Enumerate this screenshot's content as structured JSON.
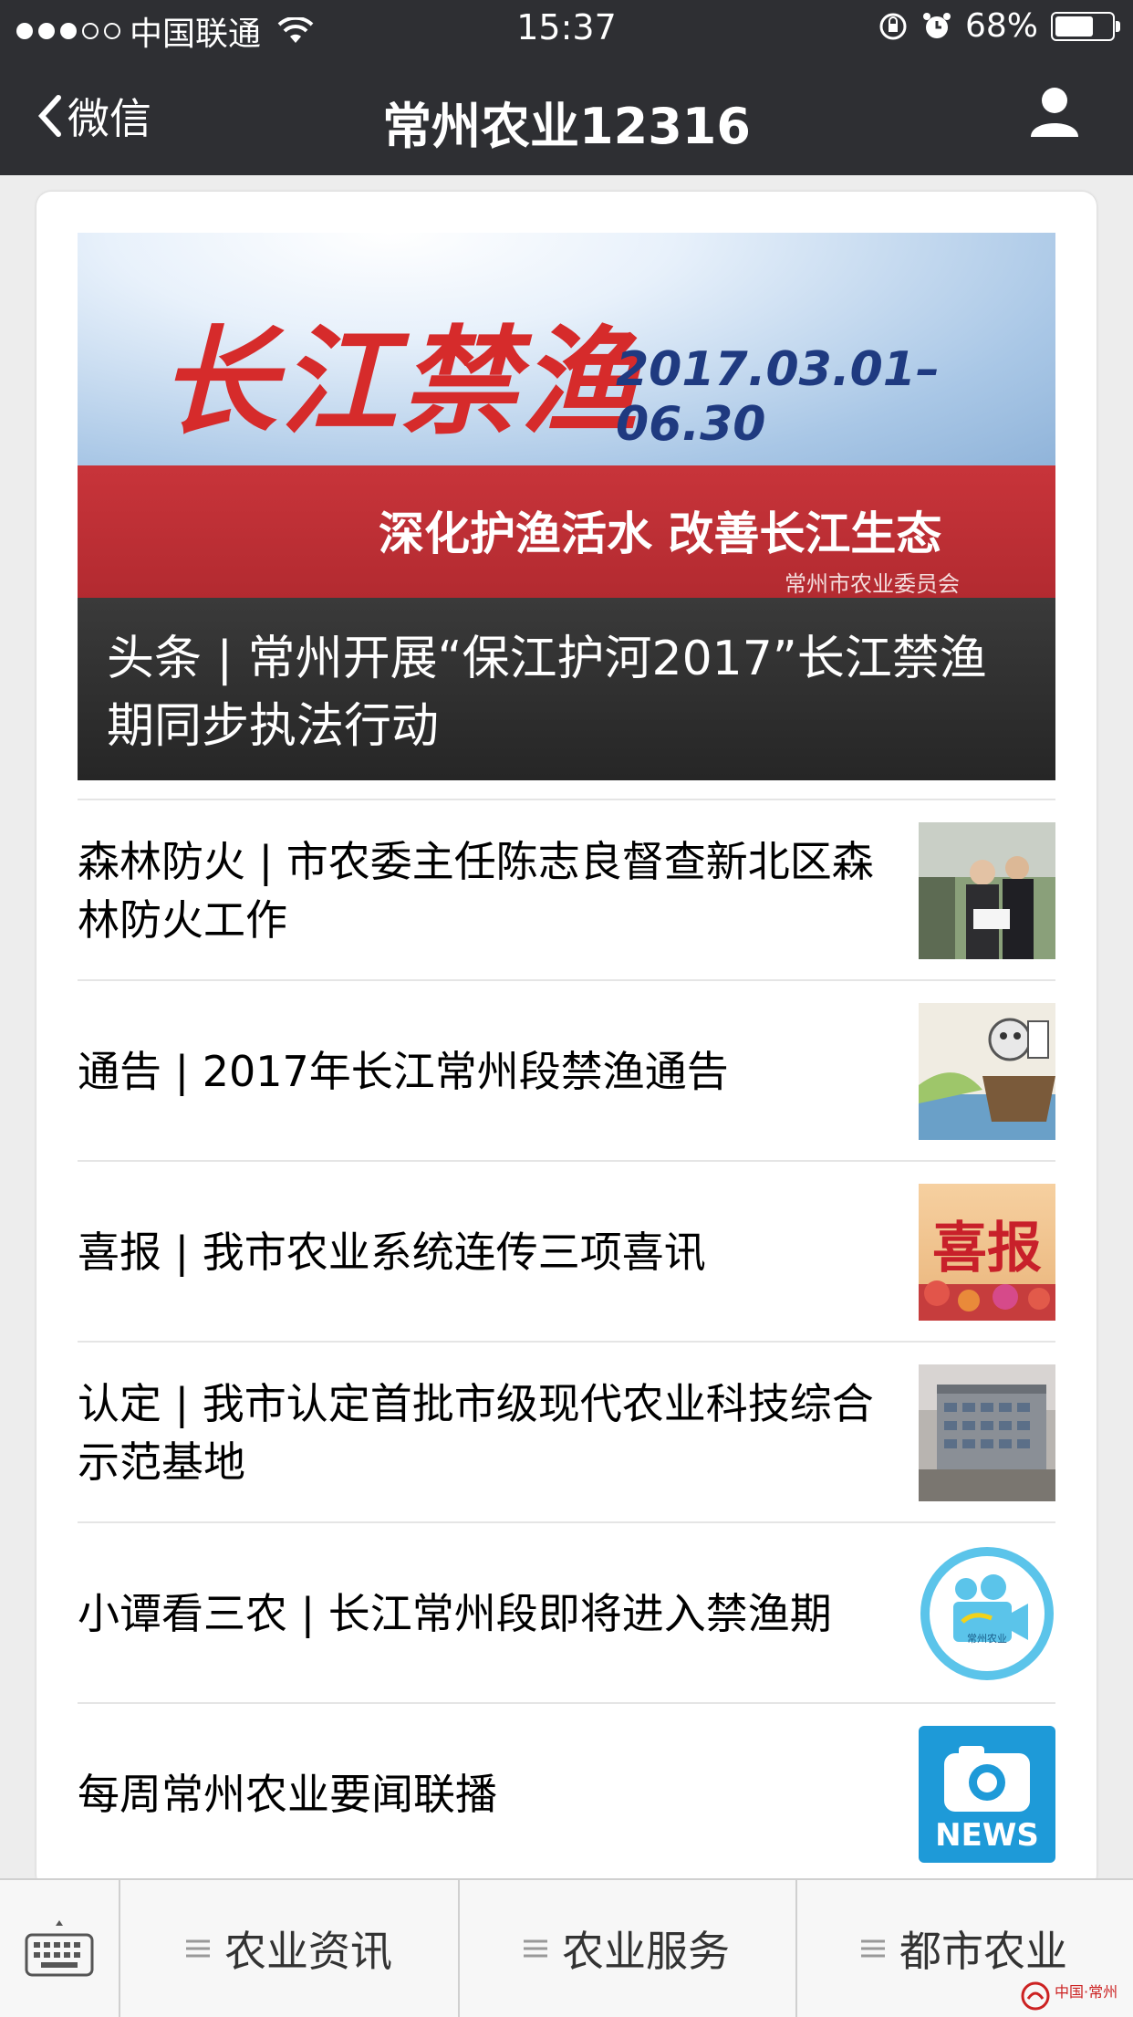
{
  "status_bar": {
    "carrier": "中国联通",
    "time": "15:37",
    "battery_percent": "68%",
    "battery_level": 0.68,
    "signal_bars": 3,
    "signal_total": 5
  },
  "nav": {
    "back_label": "微信",
    "title": "常州农业12316"
  },
  "hero": {
    "calligraphy": "长江禁渔",
    "dates": "2017.03.01–06.30",
    "slogan": "深化护渔活水   改善长江生态",
    "org": "常州市农业委员会",
    "caption": "头条 | 常州开展“保江护河2017”长江禁渔期同步执法行动"
  },
  "articles": [
    {
      "title": "森林防火 | 市农委主任陈志良督查新北区森林防火工作"
    },
    {
      "title": "通告 | 2017年长江常州段禁渔通告"
    },
    {
      "title": "喜报 | 我市农业系统连传三项喜讯",
      "thumb_text": "喜报"
    },
    {
      "title": "认定 | 我市认定首批市级现代农业科技综合示范基地"
    },
    {
      "title": "小谭看三农 | 长江常州段即将进入禁渔期",
      "thumb_text": "常州农业"
    },
    {
      "title": "每周常州农业要闻联播",
      "thumb_text": "NEWS"
    }
  ],
  "menu": {
    "items": [
      {
        "label": "农业资讯"
      },
      {
        "label": "农业服务"
      },
      {
        "label": "都市农业"
      }
    ]
  },
  "watermark": "中国·常州"
}
